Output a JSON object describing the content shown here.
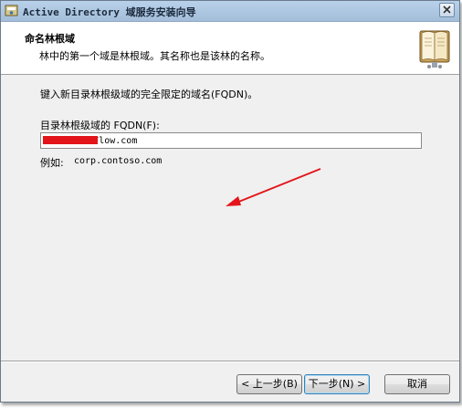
{
  "window": {
    "title": "Active Directory 域服务安装向导"
  },
  "header": {
    "title": "命名林根域",
    "subtitle": "林中的第一个域是林根域。其名称也是该林的名称。"
  },
  "content": {
    "instruction": "键入新目录林根级域的完全限定的域名(FQDN)。",
    "field_label": "目录林根级域的 FQDN(F):",
    "fqdn_value": "        dFlow.com",
    "example_label": "例如:",
    "example_value": "corp.contoso.com"
  },
  "buttons": {
    "back": "< 上一步(B)",
    "next": "下一步(N) >",
    "cancel": "取消"
  },
  "colors": {
    "annotation_arrow": "#e3141a",
    "redaction": "#e3141a",
    "titlebar": "#b9d1ea"
  },
  "icons": {
    "app": "ad-wizard-icon",
    "close": "close-icon",
    "header": "book-icon"
  }
}
